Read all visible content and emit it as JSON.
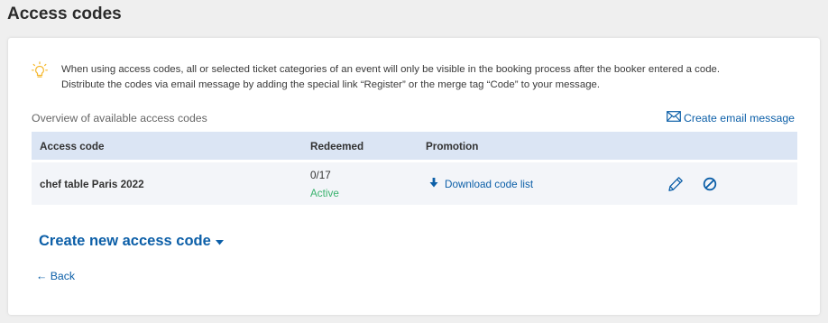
{
  "page": {
    "title": "Access codes"
  },
  "hint": {
    "icon": "lightbulb-icon",
    "line1": "When using access codes, all or selected ticket categories of an event will only be visible in the booking process after the booker entered a code.",
    "line2": "Distribute the codes via email message by adding the special link “Register” or the merge tag “Code” to your message."
  },
  "overview": {
    "label": "Overview of available access codes",
    "email_link": "Create email message",
    "email_icon": "envelope-icon"
  },
  "table": {
    "headers": {
      "code": "Access code",
      "redeemed": "Redeemed",
      "promotion": "Promotion"
    },
    "rows": [
      {
        "code": "chef table Paris 2022",
        "redeemed": "0/17",
        "status": "Active",
        "promotion_link": "Download code list"
      }
    ]
  },
  "actions": {
    "create_new": "Create new access code",
    "back": "← Back"
  },
  "colors": {
    "accent": "#0c5fa8",
    "status_active": "#3bb36f",
    "header_bg": "#dbe5f4",
    "hint_icon": "#f5b82e"
  }
}
